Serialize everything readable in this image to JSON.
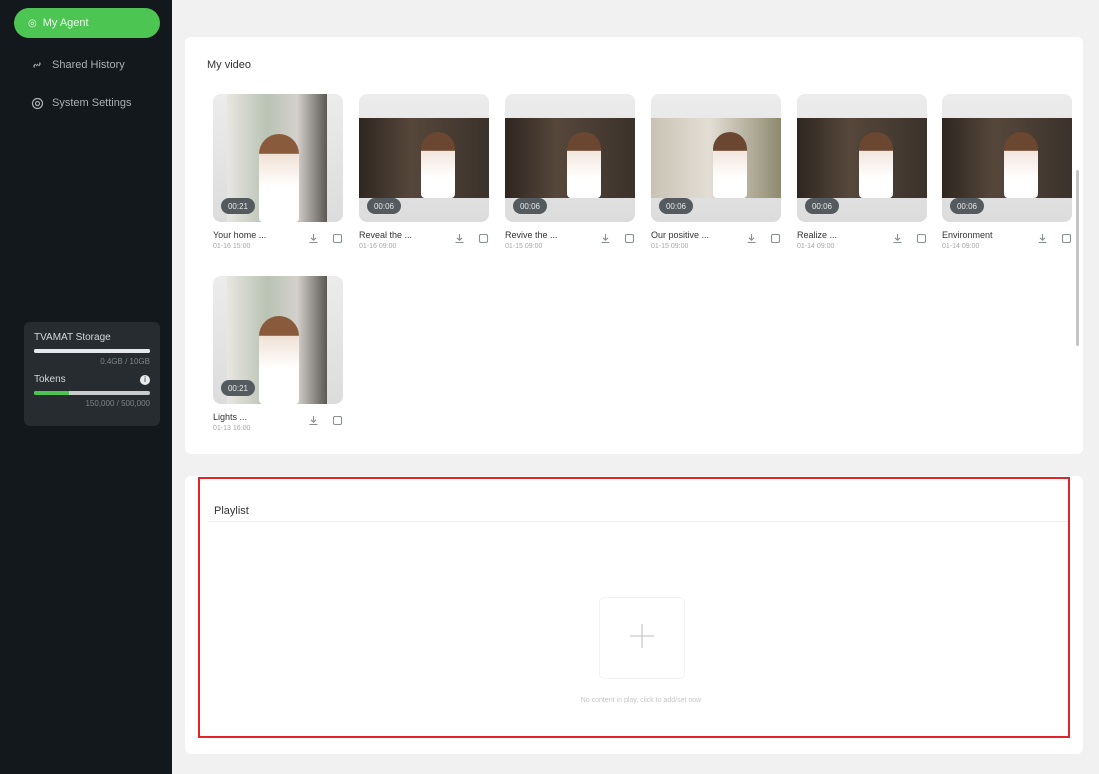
{
  "sidebar": {
    "active_item": "My Agent",
    "items": [
      {
        "label": "Shared History",
        "icon": "link-icon"
      },
      {
        "label": "System Settings",
        "icon": "gear-icon"
      }
    ],
    "storage": {
      "label": "TVAMAT Storage",
      "usage_text": "0.4GB / 10GB",
      "fraction": 0.04
    },
    "tokens": {
      "label": "Tokens",
      "usage_text": "150,000 / 500,000",
      "fraction": 0.3
    }
  },
  "videos_panel": {
    "title": "My video",
    "videos": [
      {
        "name": "Your home ...",
        "date": "01-16 15:00",
        "duration": "00:21",
        "thumb": "portrait"
      },
      {
        "name": "Reveal the ...",
        "date": "01-16 09:00",
        "duration": "00:06",
        "thumb": "dark"
      },
      {
        "name": "Revive the ...",
        "date": "01-15 09:00",
        "duration": "00:06",
        "thumb": "dark"
      },
      {
        "name": "Our positive ...",
        "date": "01-15 09:00",
        "duration": "00:06",
        "thumb": "light"
      },
      {
        "name": "Realize ...",
        "date": "01-14 09:00",
        "duration": "00:06",
        "thumb": "dark"
      },
      {
        "name": "Environment",
        "date": "01-14 09:00",
        "duration": "00:06",
        "thumb": "dark"
      },
      {
        "name": "Lights ...",
        "date": "01-13 16:00",
        "duration": "00:21",
        "thumb": "portrait"
      }
    ]
  },
  "playlist_panel": {
    "title": "Playlist",
    "empty_hint": "No content in play, click to add/set now"
  }
}
